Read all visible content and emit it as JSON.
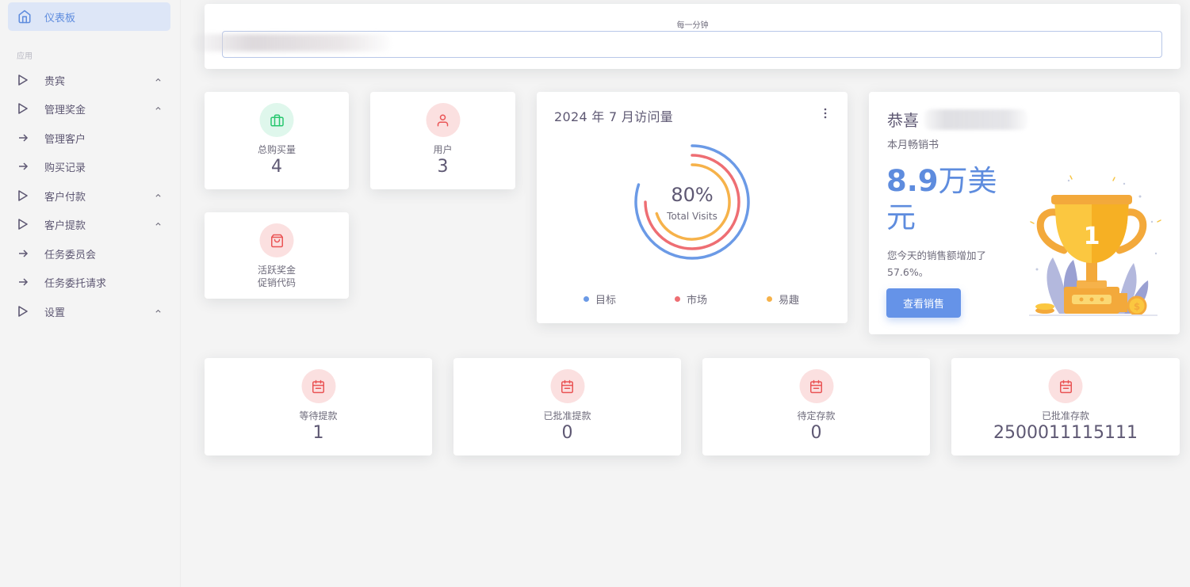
{
  "sidebar": {
    "active_item": "仪表板",
    "section_label": "应用",
    "items": [
      {
        "label": "贵宾",
        "type": "group"
      },
      {
        "label": "管理奖金",
        "type": "group"
      },
      {
        "label": "管理客户",
        "type": "link"
      },
      {
        "label": "购买记录",
        "type": "link"
      },
      {
        "label": "客户付款",
        "type": "group"
      },
      {
        "label": "客户提款",
        "type": "group"
      },
      {
        "label": "任务委员会",
        "type": "link"
      },
      {
        "label": "任务委托请求",
        "type": "link"
      },
      {
        "label": "设置",
        "type": "group"
      }
    ]
  },
  "top": {
    "frequency_label": "每一分钟"
  },
  "stats": {
    "total_purchase": {
      "label": "总购买量",
      "value": "4"
    },
    "users": {
      "label": "用户",
      "value": "3"
    },
    "bonus": {
      "label": "活跃奖金",
      "sub": "促销代码"
    }
  },
  "visits": {
    "title": "2024 年 7 月访问量",
    "percent_label": "80%",
    "center_caption": "Total Visits",
    "legend": [
      {
        "label": "目标",
        "color": "#6b9ae6"
      },
      {
        "label": "市场",
        "color": "#ee6e73"
      },
      {
        "label": "易趣",
        "color": "#f6b24a"
      }
    ]
  },
  "chart_data": {
    "type": "pie",
    "title": "2024 年 7 月访问量",
    "center_value": "80%",
    "center_label": "Total Visits",
    "series": [
      {
        "name": "目标",
        "value": 80
      },
      {
        "name": "市场",
        "value": 75
      },
      {
        "name": "易趣",
        "value": 70
      }
    ]
  },
  "congrats": {
    "title": "恭喜",
    "subtitle": "本月畅销书",
    "amount_number": "8.9",
    "amount_unit": "万美元",
    "desc": "您今天的销售额增加了 57.6%。",
    "button": "查看销售",
    "trophy_number": "1"
  },
  "bottom_stats": [
    {
      "label": "等待提款",
      "value": "1"
    },
    {
      "label": "已批准提款",
      "value": "0"
    },
    {
      "label": "待定存款",
      "value": "0"
    },
    {
      "label": "已批准存款",
      "value": "2500011115111"
    }
  ],
  "colors": {
    "accent": "#5e8cde",
    "success_bg": "#dff7ec",
    "success": "#28c76f",
    "danger_bg": "#fbe0e0",
    "danger": "#ea5455"
  }
}
